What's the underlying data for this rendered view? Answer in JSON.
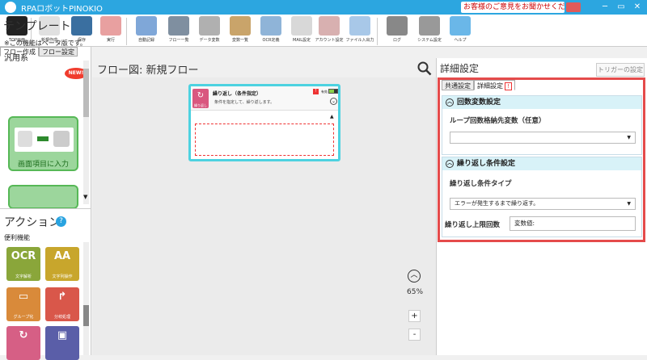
{
  "app": {
    "title": "RPAロボットPINOKIO",
    "feedback": "お客様のご意見をお聞かせください"
  },
  "window": {
    "min": "─",
    "restore": "▭",
    "close": "✕"
  },
  "toolbar": [
    {
      "label": "TOP画面",
      "color": "#222"
    },
    {
      "label": "新規作成",
      "color": "#e0e0e0"
    },
    {
      "label": "保存",
      "color": "#3a6fa0"
    },
    {
      "label": "実行",
      "color": "#e8a0a0"
    },
    {
      "label": "自動記録",
      "color": "#7fa7d8"
    },
    {
      "label": "フロー一覧",
      "color": "#7f8fa0"
    },
    {
      "label": "データ変数",
      "color": "#b0b0b0"
    },
    {
      "label": "変数一覧",
      "color": "#c9a46a"
    },
    {
      "label": "OCR定義",
      "color": "#8fb4d8"
    },
    {
      "label": "MAIL設定",
      "color": "#d8d8d8"
    },
    {
      "label": "アカウント設定",
      "color": "#d8b0b0"
    },
    {
      "label": "ファイル入出力",
      "color": "#a8c8e8"
    },
    {
      "label": "ログ",
      "color": "#888"
    },
    {
      "label": "システム設定",
      "color": "#999"
    },
    {
      "label": "ヘルプ",
      "color": "#6ab7e8"
    }
  ],
  "left": {
    "tabs": [
      "フロー作成",
      "フロー設定"
    ],
    "template_heading": "テンプレート",
    "new_badge": "NEW!",
    "beta_note": "※この機能はベータ版です。",
    "general": "汎用系",
    "card1_label": "画面項目に入力",
    "card1_icons": [
      "マウス操作",
      "キー操作"
    ],
    "action_heading": "アクション",
    "help": "?",
    "convenience": "便利機能",
    "actions": [
      {
        "big": "OCR",
        "label": "文字解析",
        "color": "#8aa63a"
      },
      {
        "big": "AA",
        "label": "文字列操作",
        "color": "#c8a62c"
      },
      {
        "big": "▭",
        "label": "グループ化",
        "color": "#d98a3a"
      },
      {
        "big": "↱",
        "label": "分岐処理",
        "color": "#d9574a"
      },
      {
        "big": "↻",
        "label": "",
        "color": "#d65f85"
      },
      {
        "big": "▣",
        "label": "",
        "color": "#5a5ea8"
      }
    ]
  },
  "center": {
    "title": "フロー図:  新規フロー",
    "zoom": "65%",
    "zoom_in": "+",
    "zoom_out": "-",
    "block": {
      "title": "繰り返し（条件指定）",
      "description": "条件を指定して、繰り返します。",
      "icon_label": "繰り返し",
      "valid": "有効"
    }
  },
  "right": {
    "title": "詳細設定",
    "trigger": "トリガーの設定",
    "tabs": [
      "共通設定",
      "詳細設定"
    ],
    "section1": {
      "title": "回数変数設定",
      "field_label": "ループ回数格納先変数（任意）",
      "field_value": ""
    },
    "section2": {
      "title": "繰り返し条件設定",
      "type_label": "繰り返し条件タイプ",
      "type_value": "エラーが発生するまで繰り返す。",
      "max_label": "繰り返し上限回数",
      "max_value": "変数値:"
    }
  }
}
